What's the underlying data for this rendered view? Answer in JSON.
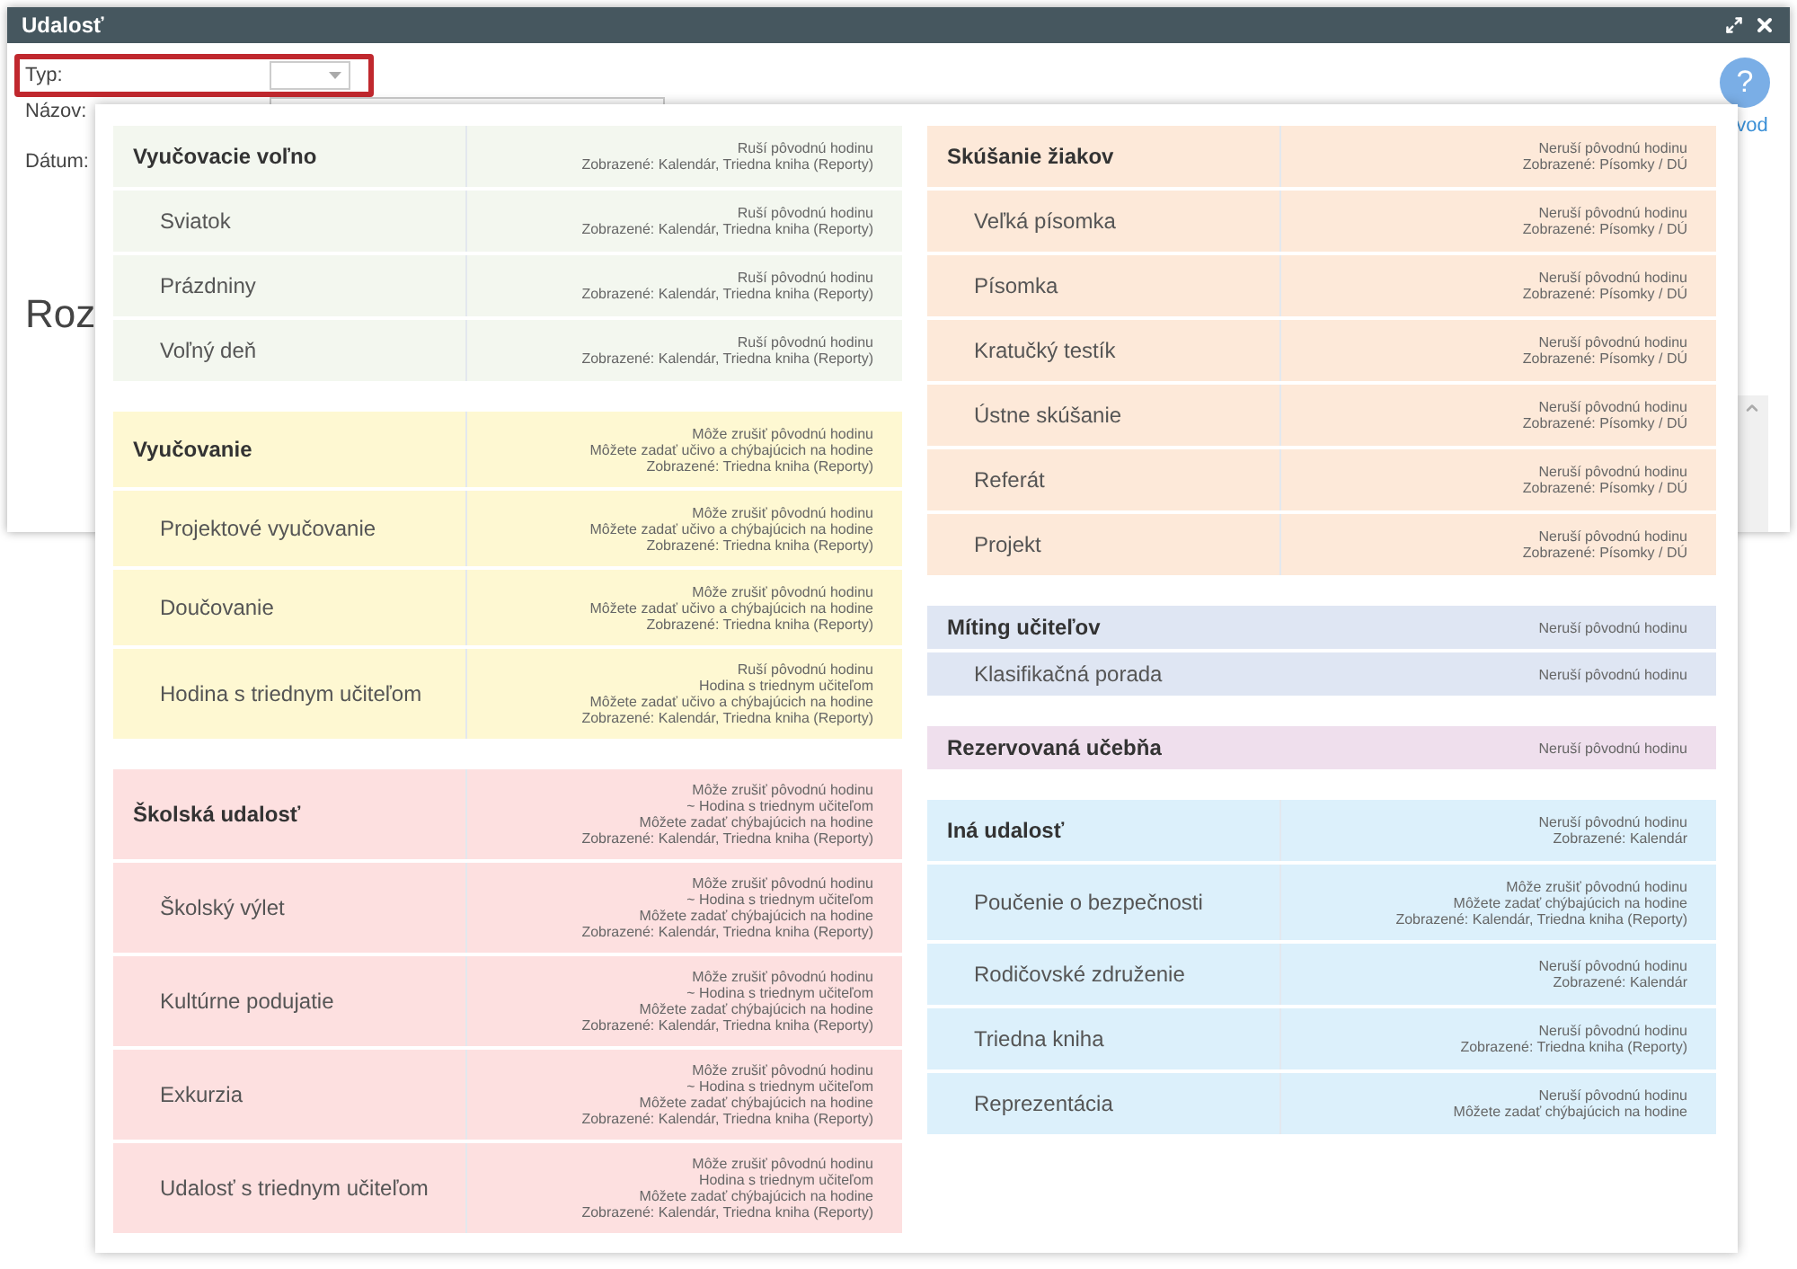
{
  "window": {
    "title": "Udalosť"
  },
  "form": {
    "type_label": "Typ:",
    "name_label": "Názov:",
    "date_label": "Dátum:",
    "heading": "Roz",
    "help_icon": "?",
    "help_label": "vod"
  },
  "dropdown": {
    "columns": [
      [
        {
          "color": "#f3f7ef",
          "items": [
            {
              "kind": "header",
              "label": "Vyučovacie voľno",
              "details": [
                "Ruší pôvodnú hodinu",
                "Zobrazené: Kalendár, Triedna kniha (Reporty)"
              ]
            },
            {
              "kind": "child",
              "label": "Sviatok",
              "details": [
                "Ruší pôvodnú hodinu",
                "Zobrazené: Kalendár, Triedna kniha (Reporty)"
              ]
            },
            {
              "kind": "child",
              "label": "Prázdniny",
              "details": [
                "Ruší pôvodnú hodinu",
                "Zobrazené: Kalendár, Triedna kniha (Reporty)"
              ]
            },
            {
              "kind": "child",
              "label": "Voľný deň",
              "details": [
                "Ruší pôvodnú hodinu",
                "Zobrazené: Kalendár, Triedna kniha (Reporty)"
              ]
            }
          ]
        },
        {
          "color": "#fef8d2",
          "items": [
            {
              "kind": "header",
              "label": "Vyučovanie",
              "details": [
                "Môže zrušiť pôvodnú hodinu",
                "Môžete zadať učivo a chýbajúcich na hodine",
                "Zobrazené: Triedna kniha (Reporty)"
              ]
            },
            {
              "kind": "child",
              "label": "Projektové vyučovanie",
              "details": [
                "Môže zrušiť pôvodnú hodinu",
                "Môžete zadať učivo a chýbajúcich na hodine",
                "Zobrazené: Triedna kniha (Reporty)"
              ]
            },
            {
              "kind": "child",
              "label": "Doučovanie",
              "details": [
                "Môže zrušiť pôvodnú hodinu",
                "Môžete zadať učivo a chýbajúcich na hodine",
                "Zobrazené: Triedna kniha (Reporty)"
              ]
            },
            {
              "kind": "child",
              "label": "Hodina s triednym učiteľom",
              "details": [
                "Ruší pôvodnú hodinu",
                "Hodina s triednym učiteľom",
                "Môžete zadať učivo a chýbajúcich na hodine",
                "Zobrazené: Kalendár, Triedna kniha (Reporty)"
              ]
            }
          ]
        },
        {
          "color": "#fde0e0",
          "items": [
            {
              "kind": "header",
              "label": "Školská udalosť",
              "details": [
                "Môže zrušiť pôvodnú hodinu",
                "~ Hodina s triednym učiteľom",
                "Môžete zadať chýbajúcich na hodine",
                "Zobrazené: Kalendár, Triedna kniha (Reporty)"
              ]
            },
            {
              "kind": "child",
              "label": "Školský výlet",
              "details": [
                "Môže zrušiť pôvodnú hodinu",
                "~ Hodina s triednym učiteľom",
                "Môžete zadať chýbajúcich na hodine",
                "Zobrazené: Kalendár, Triedna kniha (Reporty)"
              ]
            },
            {
              "kind": "child",
              "label": "Kultúrne podujatie",
              "details": [
                "Môže zrušiť pôvodnú hodinu",
                "~ Hodina s triednym učiteľom",
                "Môžete zadať chýbajúcich na hodine",
                "Zobrazené: Kalendár, Triedna kniha (Reporty)"
              ]
            },
            {
              "kind": "child",
              "label": "Exkurzia",
              "details": [
                "Môže zrušiť pôvodnú hodinu",
                "~ Hodina s triednym učiteľom",
                "Môžete zadať chýbajúcich na hodine",
                "Zobrazené: Kalendár, Triedna kniha (Reporty)"
              ]
            },
            {
              "kind": "child",
              "label": "Udalosť s triednym učiteľom",
              "details": [
                "Môže zrušiť pôvodnú hodinu",
                "Hodina s triednym učiteľom",
                "Môžete zadať chýbajúcich na hodine",
                "Zobrazené: Kalendár, Triedna kniha (Reporty)"
              ]
            }
          ]
        }
      ],
      [
        {
          "color": "#fde9d9",
          "items": [
            {
              "kind": "header",
              "label": "Skúšanie žiakov",
              "details": [
                "Neruší pôvodnú hodinu",
                "Zobrazené: Písomky / DÚ"
              ]
            },
            {
              "kind": "child",
              "label": "Veľká písomka",
              "details": [
                "Neruší pôvodnú hodinu",
                "Zobrazené: Písomky / DÚ"
              ]
            },
            {
              "kind": "child",
              "label": "Písomka",
              "details": [
                "Neruší pôvodnú hodinu",
                "Zobrazené: Písomky / DÚ"
              ]
            },
            {
              "kind": "child",
              "label": "Kratučký testík",
              "details": [
                "Neruší pôvodnú hodinu",
                "Zobrazené: Písomky / DÚ"
              ]
            },
            {
              "kind": "child",
              "label": "Ústne skúšanie",
              "details": [
                "Neruší pôvodnú hodinu",
                "Zobrazené: Písomky / DÚ"
              ]
            },
            {
              "kind": "child",
              "label": "Referát",
              "details": [
                "Neruší pôvodnú hodinu",
                "Zobrazené: Písomky / DÚ"
              ]
            },
            {
              "kind": "child",
              "label": "Projekt",
              "details": [
                "Neruší pôvodnú hodinu",
                "Zobrazené: Písomky / DÚ"
              ]
            }
          ]
        },
        {
          "color": "#dfe6f3",
          "items": [
            {
              "kind": "header",
              "label": "Míting učiteľov",
              "details": [
                "Neruší pôvodnú hodinu"
              ]
            },
            {
              "kind": "child",
              "label": "Klasifikačná porada",
              "details": [
                "Neruší pôvodnú hodinu"
              ]
            }
          ]
        },
        {
          "color": "#efdfed",
          "items": [
            {
              "kind": "header",
              "label": "Rezervovaná učebňa",
              "details": [
                "Neruší pôvodnú hodinu"
              ]
            }
          ]
        },
        {
          "color": "#dcf0fb",
          "items": [
            {
              "kind": "header",
              "label": "Iná udalosť",
              "details": [
                "Neruší pôvodnú hodinu",
                "Zobrazené: Kalendár"
              ]
            },
            {
              "kind": "child",
              "label": "Poučenie o bezpečnosti",
              "details": [
                "Môže zrušiť pôvodnú hodinu",
                "Môžete zadať chýbajúcich na hodine",
                "Zobrazené: Kalendár, Triedna kniha (Reporty)"
              ]
            },
            {
              "kind": "child",
              "label": "Rodičovské združenie",
              "details": [
                "Neruší pôvodnú hodinu",
                "Zobrazené: Kalendár"
              ]
            },
            {
              "kind": "child",
              "label": "Triedna kniha",
              "details": [
                "Neruší pôvodnú hodinu",
                "Zobrazené: Triedna kniha (Reporty)"
              ]
            },
            {
              "kind": "child",
              "label": "Reprezentácia",
              "details": [
                "Neruší pôvodnú hodinu",
                "Môžete zadať chýbajúcich na hodine"
              ]
            }
          ]
        }
      ]
    ]
  }
}
